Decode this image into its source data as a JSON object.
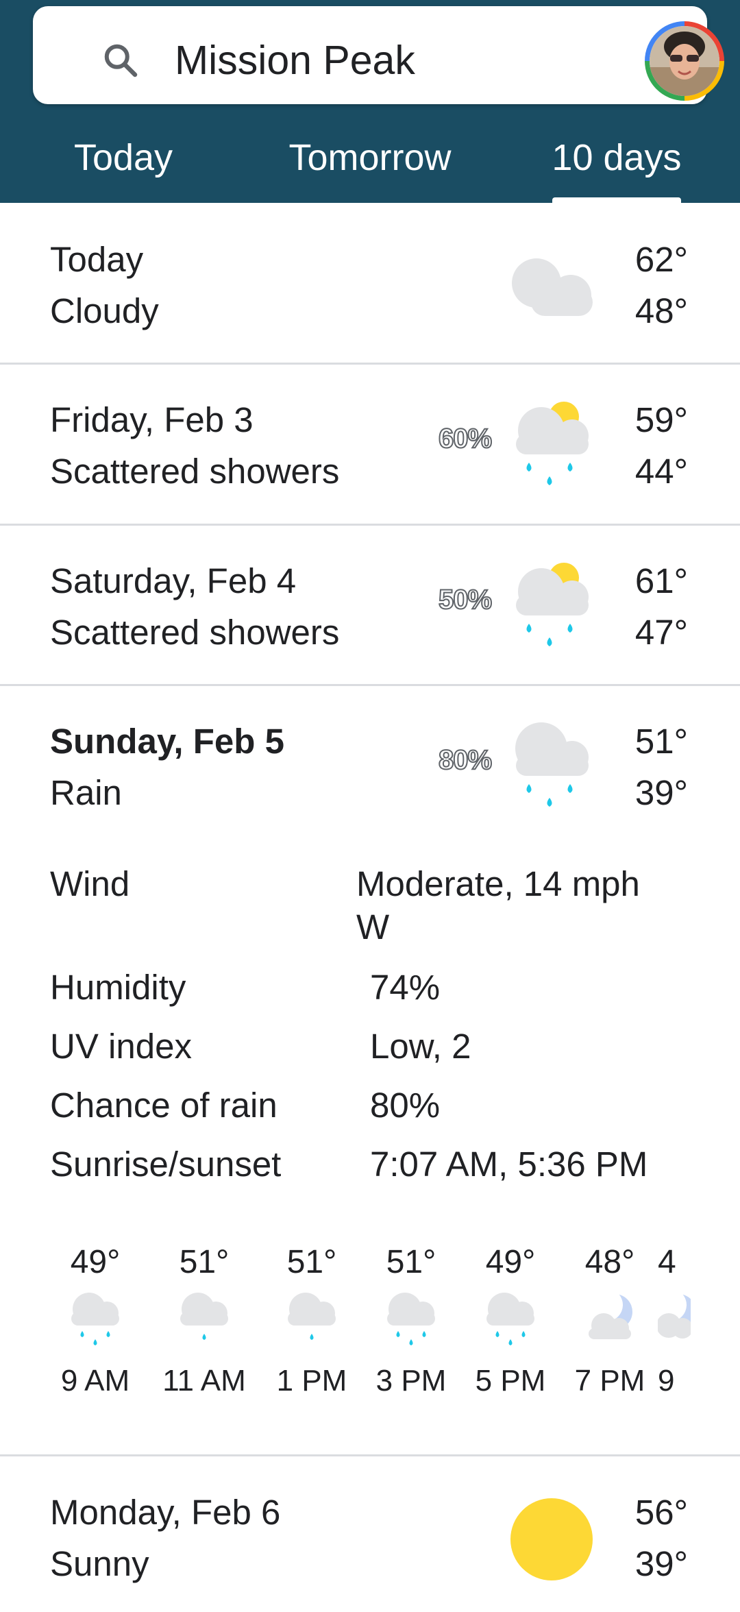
{
  "search": {
    "query": "Mission Peak"
  },
  "tabs": [
    "Today",
    "Tomorrow",
    "10 days"
  ],
  "selected_tab": "10 days",
  "days": [
    {
      "name": "Today",
      "condition": "Cloudy",
      "precip": "",
      "high": "62°",
      "low": "48°",
      "icon": "cloudy-icon"
    },
    {
      "name": "Friday, Feb 3",
      "condition": "Scattered showers",
      "precip": "60%",
      "high": "59°",
      "low": "44°",
      "icon": "scattered-showers-icon"
    },
    {
      "name": "Saturday, Feb 4",
      "condition": "Scattered showers",
      "precip": "50%",
      "high": "61°",
      "low": "47°",
      "icon": "scattered-showers-icon"
    },
    {
      "name": "Sunday, Feb 5",
      "condition": "Rain",
      "precip": "80%",
      "high": "51°",
      "low": "39°",
      "icon": "rain-icon"
    },
    {
      "name": "Monday, Feb 6",
      "condition": "Sunny",
      "precip": "",
      "high": "56°",
      "low": "39°",
      "icon": "sunny-icon"
    }
  ],
  "details": {
    "wind_label": "Wind",
    "wind_value_1": "Moderate, 14 mph",
    "wind_value_2": "W",
    "humidity_label": "Humidity",
    "humidity_value": "74%",
    "uv_label": "UV index",
    "uv_value": "Low, 2",
    "rain_label": "Chance of rain",
    "rain_value": "80%",
    "sun_label": "Sunrise/sunset",
    "sun_value": "7:07 AM, 5:36 PM"
  },
  "hourly": [
    {
      "temp": "49°",
      "time": "9 AM",
      "icon": "rain-icon"
    },
    {
      "temp": "51°",
      "time": "11 AM",
      "icon": "light-rain-icon"
    },
    {
      "temp": "51°",
      "time": "1 PM",
      "icon": "light-rain-icon"
    },
    {
      "temp": "51°",
      "time": "3 PM",
      "icon": "rain-icon"
    },
    {
      "temp": "49°",
      "time": "5 PM",
      "icon": "rain-icon"
    },
    {
      "temp": "48°",
      "time": "7 PM",
      "icon": "partly-cloudy-night-icon"
    },
    {
      "temp": "4",
      "time": "9",
      "icon": "partly-cloudy-night-icon"
    }
  ],
  "colors": {
    "header": "#1a4d63",
    "rain": "#1ec8e8",
    "sun": "#fdd835",
    "cloud": "#e3e4e6"
  }
}
